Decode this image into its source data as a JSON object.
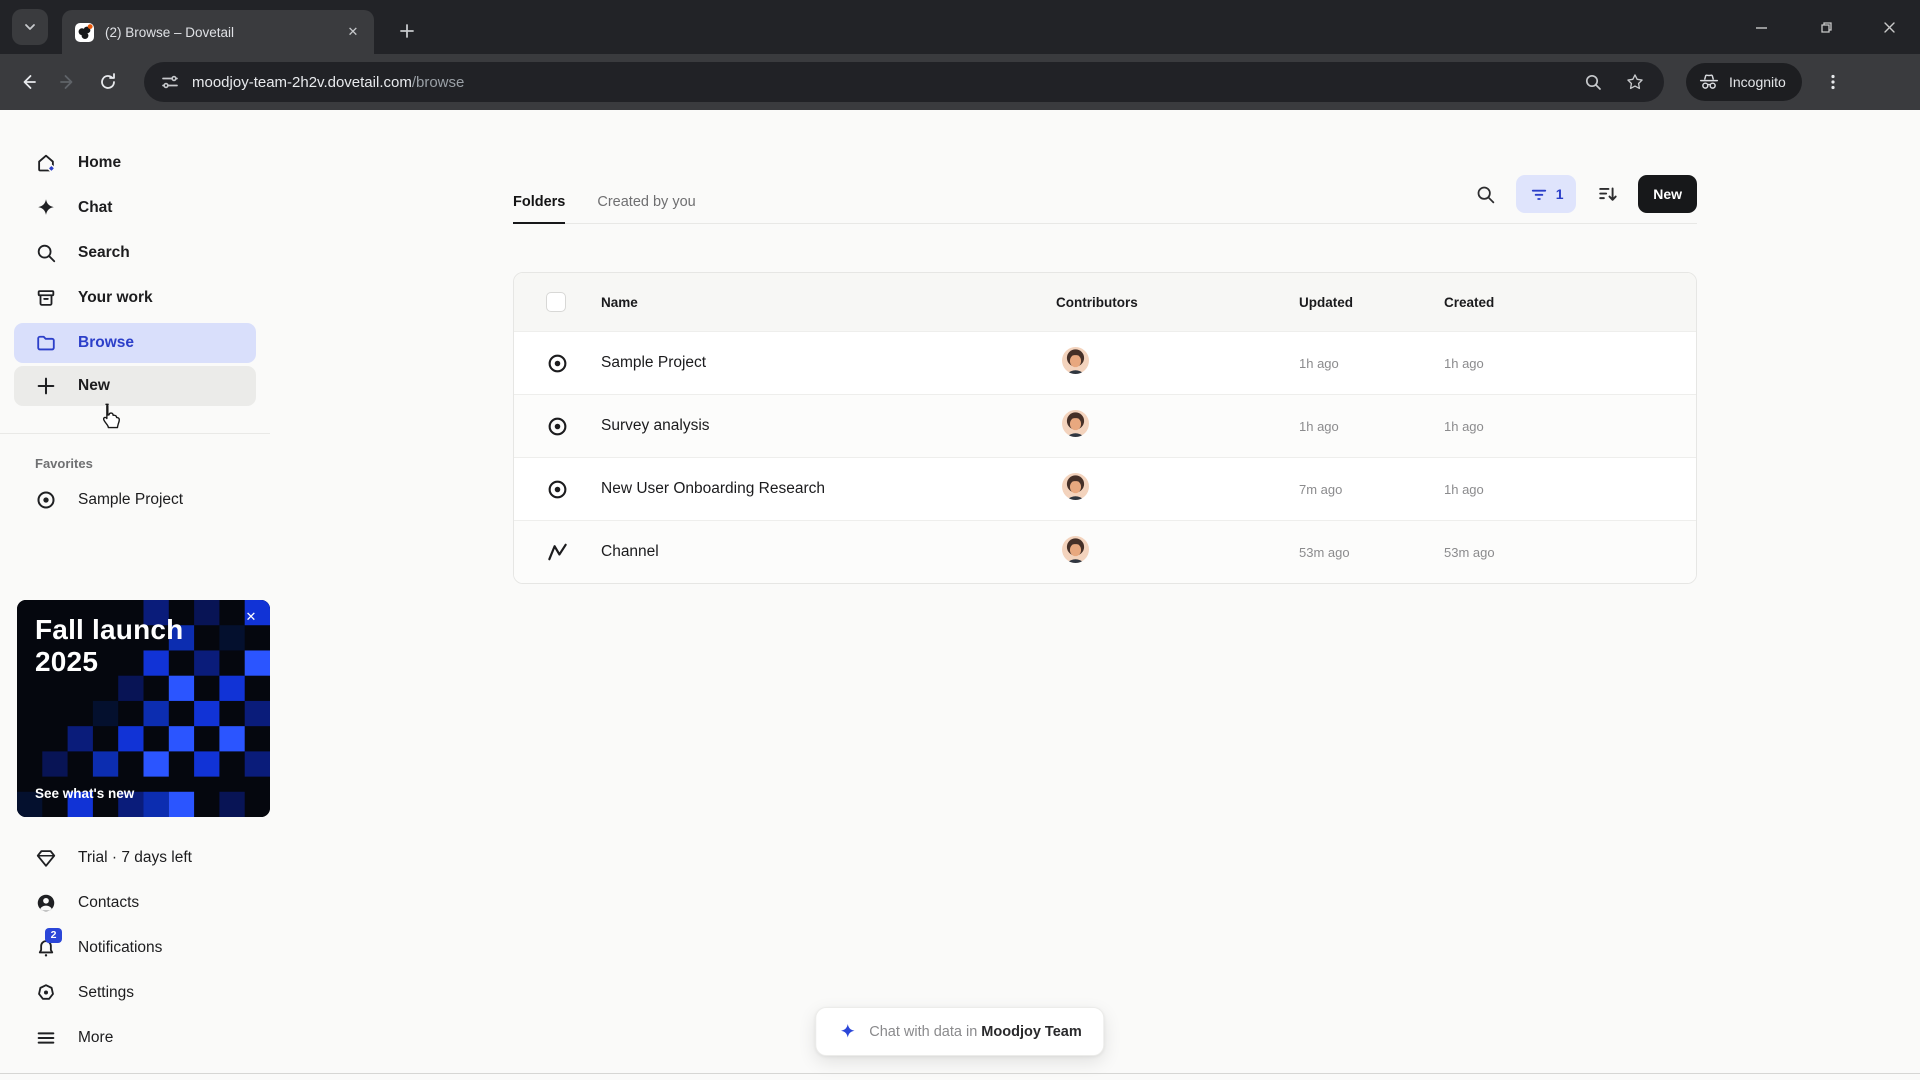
{
  "browser": {
    "tab_title": "(2) Browse – Dovetail",
    "url_host": "moodjoy-team-2h2v.dovetail.com",
    "url_path": "/browse",
    "incognito_label": "Incognito"
  },
  "sidebar": {
    "items": [
      {
        "label": "Home"
      },
      {
        "label": "Chat"
      },
      {
        "label": "Search"
      },
      {
        "label": "Your work"
      },
      {
        "label": "Browse"
      },
      {
        "label": "New"
      }
    ],
    "favorites_label": "Favorites",
    "favorites": [
      {
        "label": "Sample Project"
      }
    ],
    "banner": {
      "title": "Fall launch 2025",
      "cta": "See what's new",
      "close": "✕"
    },
    "footer_items": [
      {
        "label": "Trial · 7 days left"
      },
      {
        "label": "Contacts"
      },
      {
        "label": "Notifications",
        "badge": "2"
      },
      {
        "label": "Settings"
      },
      {
        "label": "More"
      }
    ]
  },
  "main": {
    "tabs": [
      {
        "label": "Folders"
      },
      {
        "label": "Created by you"
      }
    ],
    "controls": {
      "filter_count": "1",
      "new_label": "New"
    },
    "table": {
      "headers": [
        "Name",
        "Contributors",
        "Updated",
        "Created"
      ],
      "rows": [
        {
          "name": "Sample Project",
          "updated": "1h ago",
          "created": "1h ago"
        },
        {
          "name": "Survey analysis",
          "updated": "1h ago",
          "created": "1h ago"
        },
        {
          "name": "New User Onboarding Research",
          "updated": "7m ago",
          "created": "1h ago"
        },
        {
          "name": "Channel",
          "updated": "53m ago",
          "created": "53m ago"
        }
      ]
    },
    "chat_bar": {
      "prefix": "Chat with data in",
      "team": "Moodjoy Team"
    }
  },
  "colors": {
    "accent_blue": "#2c3fc9",
    "active_pill": "#d9dffb",
    "new_button": "#17181a",
    "banner_blue": "#1133d6",
    "badge_blue": "#2b46d8"
  }
}
